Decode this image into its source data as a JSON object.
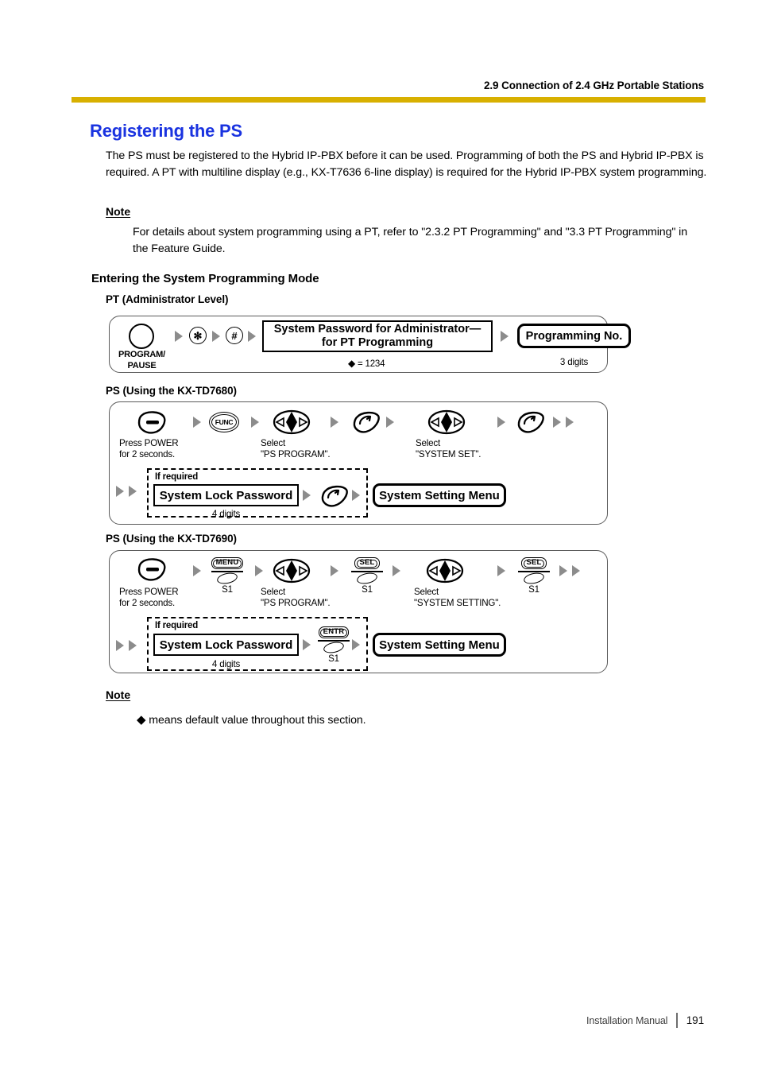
{
  "header": {
    "section": "2.9 Connection of 2.4 GHz Portable Stations",
    "rule_color": "#d8b000"
  },
  "heading": {
    "title": "Registering the PS",
    "color": "#1a33e0"
  },
  "intro": "The PS must be registered to the Hybrid IP-PBX before it can be used. Programming of both the PS and Hybrid IP-PBX is required. A PT with multiline display (e.g., KX-T7636 6-line display) is required for the Hybrid IP-PBX system programming.",
  "note_top": {
    "label": "Note",
    "text": "For details about system programming using a PT, refer to \"2.3.2 PT Programming\" and \"3.3 PT Programming\" in the Feature Guide."
  },
  "section_heading": "Entering the System Programming Mode",
  "pt": {
    "subheading": "PT (Administrator Level)",
    "program_pause_label": "PROGRAM/\nPAUSE",
    "key_star": "✻",
    "key_hash": "#",
    "password_box": "System Password for Administrator—\nfor PT Programming",
    "password_default": "= 1234",
    "programming_no": "Programming No.",
    "programming_no_caption": "3 digits"
  },
  "ps7680": {
    "subheading": "PS (Using the KX-TD7680)",
    "power_caption": "Press POWER\nfor 2 seconds.",
    "func_label": "FUNC",
    "select_ps_program": "Select\n\"PS PROGRAM\".",
    "select_system_set": "Select\n\"SYSTEM SET\".",
    "if_required": "If required",
    "lock_password": "System Lock Password",
    "lock_password_caption": "4 digits",
    "system_setting_menu": "System Setting Menu"
  },
  "ps7690": {
    "subheading": "PS (Using the KX-TD7690)",
    "power_caption": "Press POWER\nfor 2 seconds.",
    "menu_label": "MENU",
    "sel_label": "SEL",
    "entr_label": "ENTR",
    "softkey_s1": "S1",
    "select_ps_program": "Select\n\"PS PROGRAM\".",
    "select_system_setting": "Select\n\"SYSTEM SETTING\".",
    "if_required": "If required",
    "lock_password": "System Lock Password",
    "lock_password_caption": "4 digits",
    "system_setting_menu": "System Setting Menu"
  },
  "note_bottom": {
    "label": "Note",
    "text": "means default value throughout this section."
  },
  "footer": {
    "manual": "Installation Manual",
    "page": "191"
  }
}
